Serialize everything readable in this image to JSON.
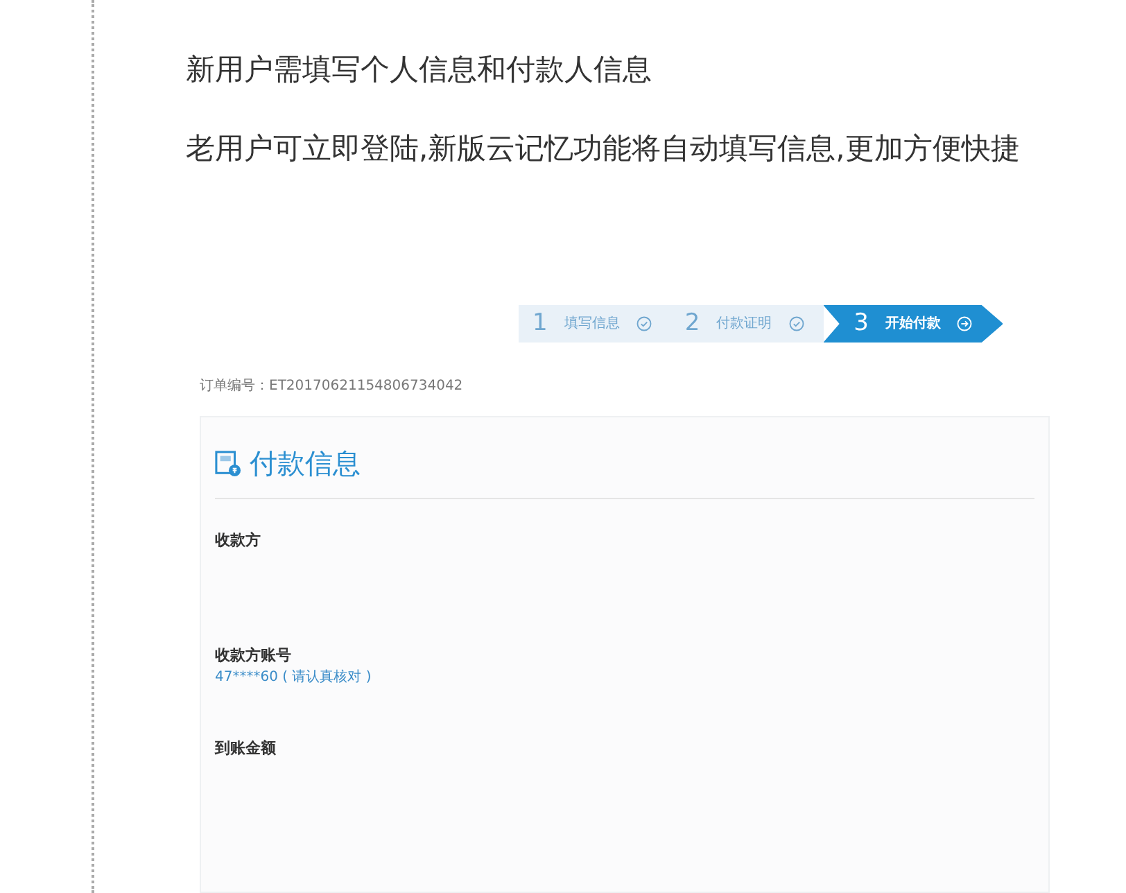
{
  "intro": [
    "新用户需填写个人信息和付款人信息",
    "老用户可立即登陆,新版云记忆功能将自动填写信息,更加方便快捷"
  ],
  "steps": [
    {
      "number": "1",
      "label": "填写信息",
      "selected": false
    },
    {
      "number": "2",
      "label": "付款证明",
      "selected": false
    },
    {
      "number": "3",
      "label": "开始付款",
      "selected": true
    }
  ],
  "order": {
    "label": "订单编号：",
    "value": "ET20170621154806734042"
  },
  "card": {
    "title": "付款信息",
    "fields": [
      {
        "label": "收款方"
      },
      {
        "label": "收款方账号",
        "value": "47****60",
        "note": "( 请认真核对 )"
      },
      {
        "label": "到账金额"
      }
    ]
  }
}
